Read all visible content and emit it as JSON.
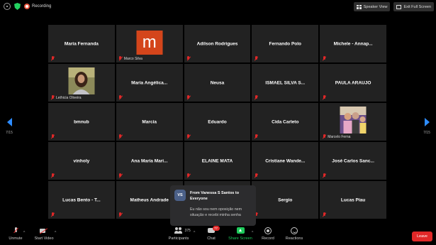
{
  "topbar": {
    "recording_label": "Recording",
    "speaker_view_label": "Speaker View",
    "exit_fullscreen_label": "Exit Full Screen"
  },
  "pager": {
    "left_label": "7/15",
    "right_label": "7/15"
  },
  "tiles": [
    {
      "name": "Maria Fernanda"
    },
    {
      "name": "Marco Silva",
      "avatar_letter": "m",
      "avatar_color": "#d4451b"
    },
    {
      "name": "Adilson Rodrigues"
    },
    {
      "name": "Fernando Polo"
    },
    {
      "name": "Michele - Annap..."
    },
    {
      "name": "Lethicia Oliveira"
    },
    {
      "name": "Maria  Angélica..."
    },
    {
      "name": "Neusa"
    },
    {
      "name": "ISMAEL SILVA S..."
    },
    {
      "name": "PAULA ARAUJO"
    },
    {
      "name": "bmnub"
    },
    {
      "name": "Marcia"
    },
    {
      "name": "Eduardo"
    },
    {
      "name": "Cida Carleto"
    },
    {
      "name": "Marcelo Ferna"
    },
    {
      "name": "vinholy"
    },
    {
      "name": "Ana Maria Mari..."
    },
    {
      "name": "ELAINE MATA"
    },
    {
      "name": "Cristiane  Wande..."
    },
    {
      "name": "José Carlos Sanc..."
    },
    {
      "name": "Lucas Bento - T..."
    },
    {
      "name": "Matheus Andrade"
    },
    {
      "name": ""
    },
    {
      "name": "Sergio"
    },
    {
      "name": "Lucas Piau"
    }
  ],
  "chat_popup": {
    "avatar_initials": "VS",
    "from": "From Vanessa S Santos to Everyone",
    "message": "Eu não sou nem oposição nem situação e recebi minha senha"
  },
  "toolbar": {
    "unmute_label": "Unmute",
    "start_video_label": "Start Video",
    "participants_label": "Participants",
    "participants_count": "375",
    "chat_label": "Chat",
    "chat_badge": "77",
    "share_label": "Share Screen",
    "record_label": "Record",
    "reactions_label": "Reactions",
    "leave_label": "Leave"
  },
  "colors": {
    "background": "#000000",
    "tile": "#222222",
    "accent_blue": "#2d8cff",
    "share_green": "#1ec95b",
    "leave_red": "#e02828",
    "recording": "#e8563f"
  }
}
